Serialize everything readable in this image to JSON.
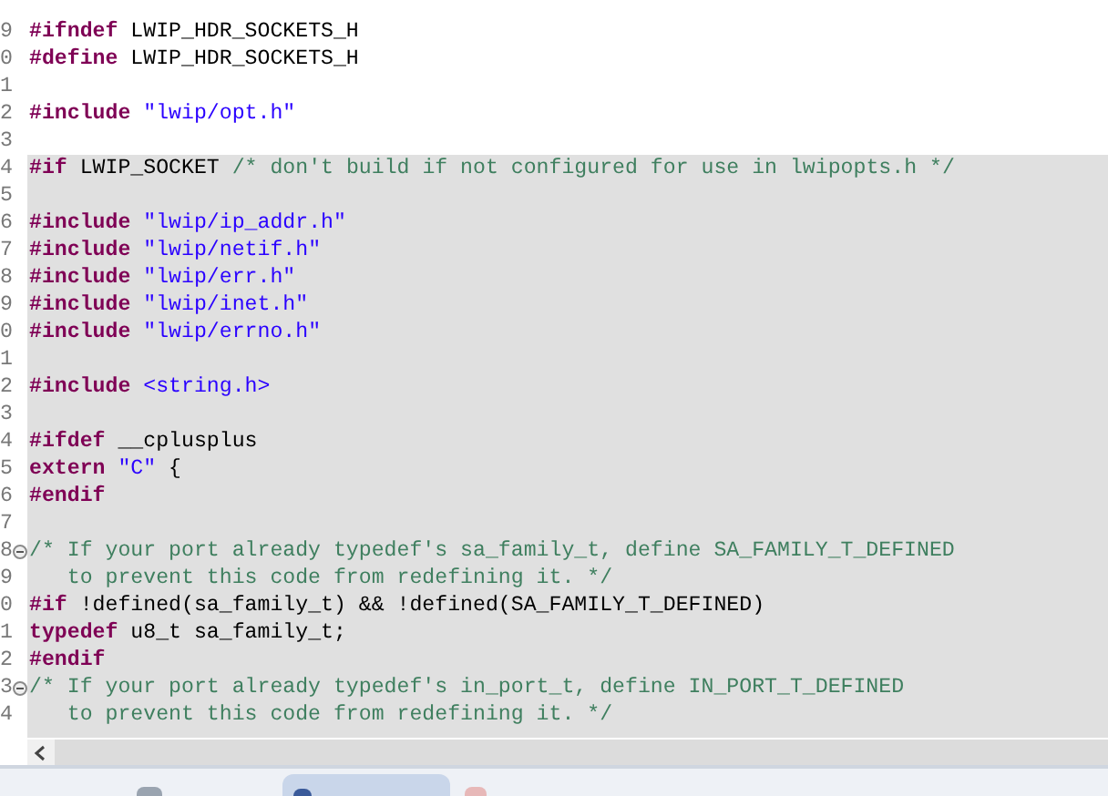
{
  "editor": {
    "lines": [
      {
        "number": "9",
        "highlighted": false,
        "tokens": [
          {
            "kind": "directive",
            "text": "#ifndef"
          },
          {
            "kind": "plain",
            "text": " LWIP_HDR_SOCKETS_H"
          }
        ]
      },
      {
        "number": "0",
        "highlighted": false,
        "tokens": [
          {
            "kind": "directive",
            "text": "#define"
          },
          {
            "kind": "plain",
            "text": " LWIP_HDR_SOCKETS_H"
          }
        ]
      },
      {
        "number": "1",
        "highlighted": false
      },
      {
        "number": "2",
        "highlighted": false,
        "tokens": [
          {
            "kind": "directive",
            "text": "#include "
          },
          {
            "kind": "string",
            "text": "\"lwip/opt.h\""
          }
        ]
      },
      {
        "number": "3",
        "highlighted": false
      },
      {
        "number": "4",
        "highlighted": true,
        "tokens": [
          {
            "kind": "directive",
            "text": "#if"
          },
          {
            "kind": "plain",
            "text": " LWIP_SOCKET "
          },
          {
            "kind": "comment",
            "text": "/* don't build if not configured for use in lwipopts.h */"
          }
        ]
      },
      {
        "number": "5",
        "highlighted": true
      },
      {
        "number": "6",
        "highlighted": true,
        "tokens": [
          {
            "kind": "directive",
            "text": "#include "
          },
          {
            "kind": "string",
            "text": "\"lwip/ip_addr.h\""
          }
        ]
      },
      {
        "number": "7",
        "highlighted": true,
        "tokens": [
          {
            "kind": "directive",
            "text": "#include "
          },
          {
            "kind": "string",
            "text": "\"lwip/netif.h\""
          }
        ]
      },
      {
        "number": "8",
        "highlighted": true,
        "tokens": [
          {
            "kind": "directive",
            "text": "#include "
          },
          {
            "kind": "string",
            "text": "\"lwip/err.h\""
          }
        ]
      },
      {
        "number": "9",
        "highlighted": true,
        "tokens": [
          {
            "kind": "directive",
            "text": "#include "
          },
          {
            "kind": "string",
            "text": "\"lwip/inet.h\""
          }
        ]
      },
      {
        "number": "0",
        "highlighted": true,
        "tokens": [
          {
            "kind": "directive",
            "text": "#include "
          },
          {
            "kind": "string",
            "text": "\"lwip/errno.h\""
          }
        ]
      },
      {
        "number": "1",
        "highlighted": true
      },
      {
        "number": "2",
        "highlighted": true,
        "tokens": [
          {
            "kind": "directive",
            "text": "#include "
          },
          {
            "kind": "string",
            "text": "<string.h>"
          }
        ]
      },
      {
        "number": "3",
        "highlighted": true
      },
      {
        "number": "4",
        "highlighted": true,
        "tokens": [
          {
            "kind": "directive",
            "text": "#ifdef"
          },
          {
            "kind": "plain",
            "text": " __cplusplus"
          }
        ]
      },
      {
        "number": "5",
        "highlighted": true,
        "tokens": [
          {
            "kind": "keyword",
            "text": "extern "
          },
          {
            "kind": "string",
            "text": "\"C\""
          },
          {
            "kind": "plain",
            "text": " {"
          }
        ]
      },
      {
        "number": "6",
        "highlighted": true,
        "tokens": [
          {
            "kind": "directive",
            "text": "#endif"
          }
        ]
      },
      {
        "number": "7",
        "highlighted": true
      },
      {
        "number": "8",
        "highlighted": true,
        "fold": true,
        "tokens": [
          {
            "kind": "comment",
            "text": "/* If your port already typedef's sa_family_t, define SA_FAMILY_T_DEFINED"
          }
        ]
      },
      {
        "number": "9",
        "highlighted": true,
        "tokens": [
          {
            "kind": "comment",
            "text": "   to prevent this code from redefining it. */"
          }
        ]
      },
      {
        "number": "0",
        "highlighted": true,
        "tokens": [
          {
            "kind": "directive",
            "text": "#if"
          },
          {
            "kind": "plain",
            "text": " !defined(sa_family_t) && !defined(SA_FAMILY_T_DEFINED)"
          }
        ]
      },
      {
        "number": "1",
        "highlighted": true,
        "tokens": [
          {
            "kind": "keyword",
            "text": "typedef"
          },
          {
            "kind": "plain",
            "text": " u8_t sa_family_t;"
          }
        ]
      },
      {
        "number": "2",
        "highlighted": true,
        "tokens": [
          {
            "kind": "directive",
            "text": "#endif"
          }
        ]
      },
      {
        "number": "3",
        "highlighted": true,
        "fold": true,
        "tokens": [
          {
            "kind": "comment",
            "text": "/* If your port already typedef's in_port_t, define IN_PORT_T_DEFINED"
          }
        ]
      },
      {
        "number": "4",
        "highlighted": true,
        "tokens": [
          {
            "kind": "comment",
            "text": "   to prevent this code from redefining it. */"
          }
        ]
      }
    ]
  }
}
